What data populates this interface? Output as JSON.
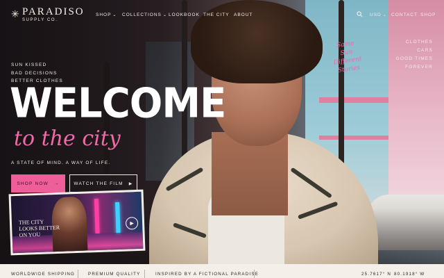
{
  "brand": {
    "name": "PARADISO",
    "sub": "SUPPLY CO."
  },
  "nav": {
    "shop": "SHOP",
    "collections": "COLLECTIONS",
    "lookbook": "LOOKBOOK",
    "city": "THE CITY",
    "about": "ABOUT",
    "currency": "USD",
    "contact": "CONTACT",
    "shop_right": "SHOP"
  },
  "side_right": [
    "CLOTHES",
    "CARS",
    "GOOD TIMES",
    "FOREVER"
  ],
  "side_left": [
    "SUN KISSED",
    "BAD DECISIONS",
    "BETTER CLOTHES"
  ],
  "hero": {
    "headline": "WELCOME",
    "script_line": "to the city",
    "tagline": "A STATE OF MIND. A WAY OF LIFE."
  },
  "buttons": {
    "shop_now": "SHOP NOW",
    "shop_arrow": "→",
    "watch_film": "THE FILM",
    "watch_prefix": "WATCH",
    "play": "▶"
  },
  "card": {
    "line1": "THE CITY",
    "line2": "LOOKS BETTER",
    "line3": "ON YOU"
  },
  "script_note": [
    "Same",
    "Sun",
    "Different",
    "Stories"
  ],
  "footer": {
    "shipping": "WORLDWIDE SHIPPING",
    "quality": "PREMIUM QUALITY",
    "inspired": "INSPIRED BY A FICTIONAL PARADISE",
    "lat": "25.7617° N",
    "lon": "80.1918° W"
  },
  "colors": {
    "accent": "#ee5f9a",
    "script": "#f06aa7",
    "footer_bg": "#f4efe8"
  },
  "icons": {
    "search": "search-icon",
    "logo_mark": "starburst-icon"
  }
}
